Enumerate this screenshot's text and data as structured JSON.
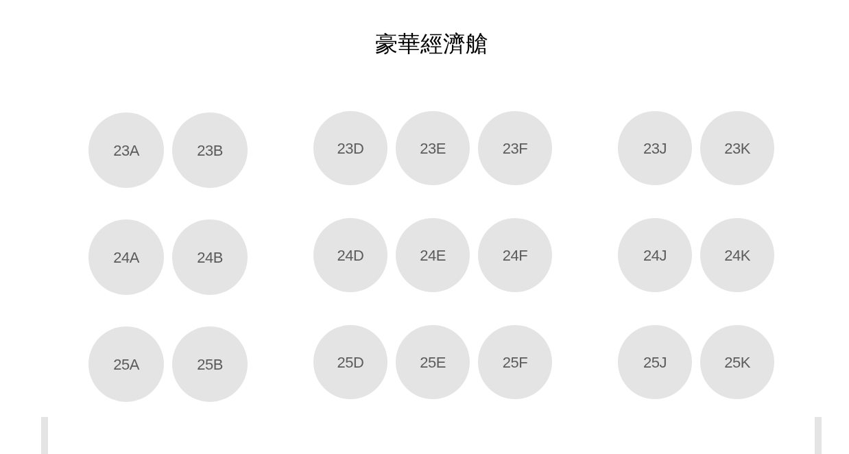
{
  "title": "豪華經濟艙",
  "rows": [
    {
      "blocks": [
        {
          "seats": [
            "23A",
            "23B"
          ]
        },
        {
          "seats": [
            "23D",
            "23E",
            "23F"
          ]
        },
        {
          "seats": [
            "23J",
            "23K"
          ]
        }
      ]
    },
    {
      "blocks": [
        {
          "seats": [
            "24A",
            "24B"
          ]
        },
        {
          "seats": [
            "24D",
            "24E",
            "24F"
          ]
        },
        {
          "seats": [
            "24J",
            "24K"
          ]
        }
      ]
    },
    {
      "blocks": [
        {
          "seats": [
            "25A",
            "25B"
          ]
        },
        {
          "seats": [
            "25D",
            "25E",
            "25F"
          ]
        },
        {
          "seats": [
            "25J",
            "25K"
          ]
        }
      ]
    }
  ]
}
